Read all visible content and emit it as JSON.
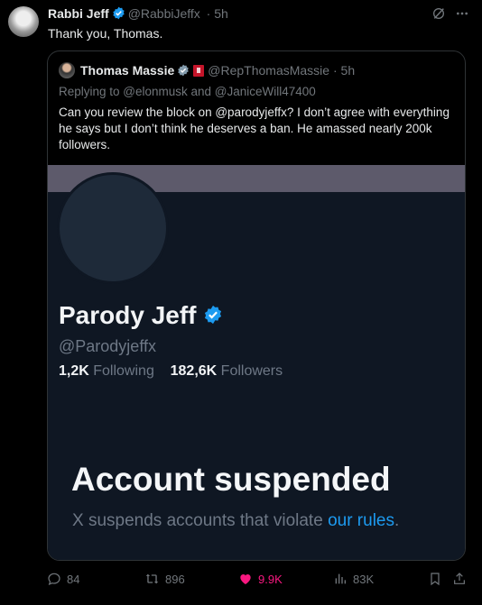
{
  "tweet": {
    "author_name": "Rabbi Jeff",
    "author_handle": "@RabbiJeffx",
    "time": "5h",
    "text": "Thank you, Thomas."
  },
  "quote": {
    "author_name": "Thomas Massie",
    "author_handle": "@RepThomasMassie",
    "time": "5h",
    "replying_to": "Replying to @elonmusk and @JaniceWill47400",
    "text": "Can you review the block on @parodyjeffx? I don’t agree with everything he says but I don’t think he deserves a ban. He amassed nearly 200k followers."
  },
  "profile_screenshot": {
    "name": "Parody Jeff",
    "handle": "@Parodyjeffx",
    "following_count": "1,2K",
    "following_label": "Following",
    "followers_count": "182,6K",
    "followers_label": "Followers",
    "suspended_title": "Account suspended",
    "suspended_text": "X suspends accounts that violate ",
    "suspended_link": "our rules",
    "suspended_end": "."
  },
  "actions": {
    "replies": "84",
    "reposts": "896",
    "likes": "9.9K",
    "views": "83K"
  },
  "colors": {
    "background": "#000000",
    "accent": "#1d9bf0",
    "like": "#f91880",
    "muted": "#71767b"
  },
  "icons": [
    "verified-badge-icon",
    "grok-icon",
    "more-icon",
    "flag-icon",
    "reply-icon",
    "repost-icon",
    "heart-icon",
    "views-icon",
    "bookmark-icon",
    "share-icon"
  ]
}
